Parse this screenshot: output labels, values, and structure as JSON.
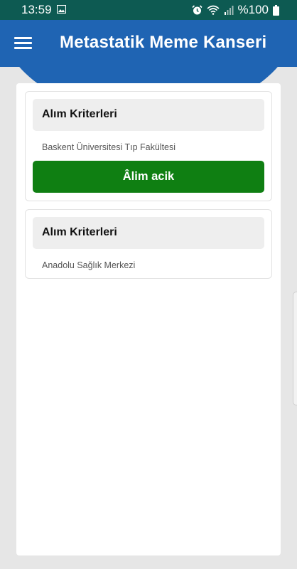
{
  "status_bar": {
    "time": "13:59",
    "battery": "%100",
    "icons": [
      "gallery-icon",
      "alarm-icon",
      "wifi-icon",
      "signal-icon",
      "battery-icon"
    ]
  },
  "app_bar": {
    "title": "Metastatik Meme Kanseri",
    "menu_icon": "hamburger-icon"
  },
  "cards": [
    {
      "header": "Alım Kriterleri",
      "institution": "Baskent Üniversitesi Tıp Fakültesi",
      "button_label": "Âlim acik"
    },
    {
      "header": "Alım Kriterleri",
      "institution": "Anadolu Sağlık Merkezi"
    }
  ],
  "colors": {
    "status_bar": "#0d5a52",
    "app_bar": "#1f64b3",
    "button": "#0f7f12",
    "background": "#e6e6e6"
  }
}
